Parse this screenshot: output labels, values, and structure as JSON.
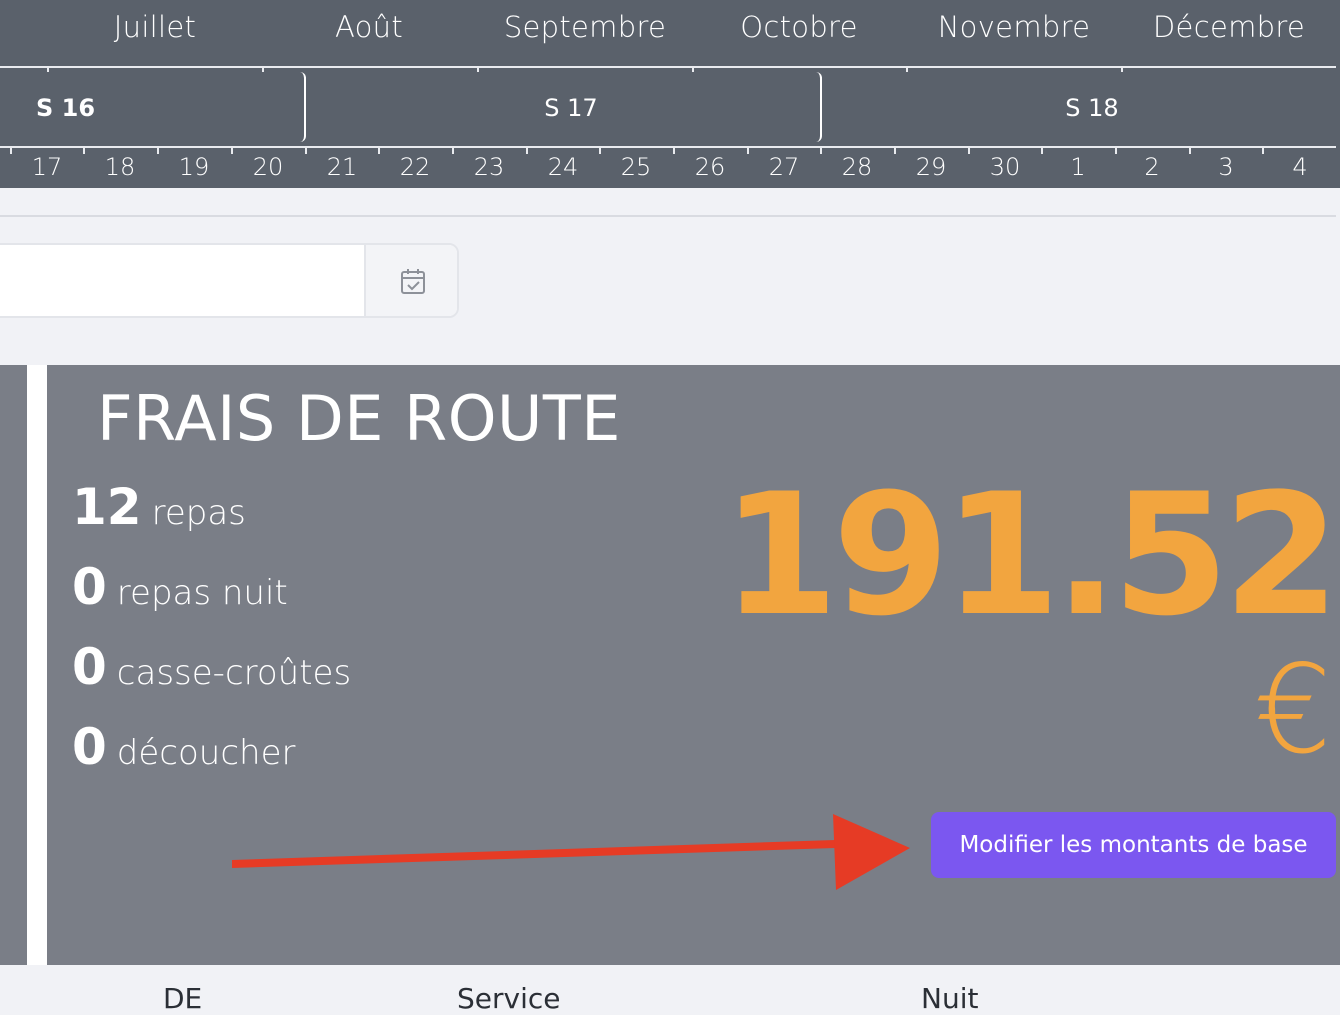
{
  "calendar": {
    "months": [
      "Juillet",
      "Août",
      "Septembre",
      "Octobre",
      "Novembre",
      "Décembre"
    ],
    "weeks": [
      {
        "label": "S 16",
        "current": true
      },
      {
        "label": "S 17",
        "current": false
      },
      {
        "label": "S 18",
        "current": false
      }
    ],
    "days": [
      "17",
      "18",
      "19",
      "20",
      "21",
      "22",
      "23",
      "24",
      "25",
      "26",
      "27",
      "28",
      "29",
      "30",
      "1",
      "2",
      "3",
      "4"
    ]
  },
  "date_field": {
    "value": "",
    "icon": "calendar-check-icon"
  },
  "card": {
    "title": "FRAIS DE ROUTE",
    "stats": [
      {
        "num": "12",
        "label": "repas"
      },
      {
        "num": "0",
        "label": "repas nuit"
      },
      {
        "num": "0",
        "label": "casse-croûtes"
      },
      {
        "num": "0",
        "label": "découcher"
      }
    ],
    "amount": "191.52",
    "currency": "€",
    "edit_button": "Modifier les montants de base"
  },
  "table_headers": [
    "DE",
    "Service",
    "Nuit"
  ],
  "colors": {
    "header_bg": "#5a616b",
    "card_bg": "#7a7e87",
    "amount": "#f2a53f",
    "button": "#7b57f0",
    "annotation_arrow": "#e63b25"
  }
}
